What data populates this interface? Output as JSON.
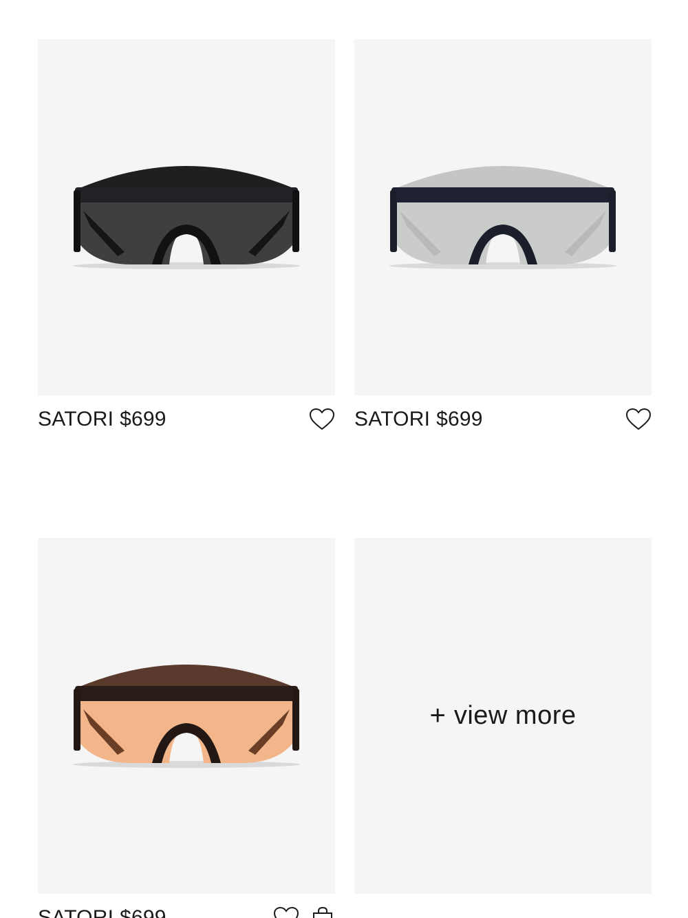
{
  "products": [
    {
      "name": "SATORI",
      "price": "$699",
      "lens_color": "#3f3f42",
      "visor_color": "#1f1f21",
      "frame_color": "#222226"
    },
    {
      "name": "SATORI",
      "price": "$699",
      "lens_color": "#c9ccc9",
      "visor_color": "#c4c6c3",
      "frame_color": "#1e2230"
    },
    {
      "name": "SATORI",
      "price": "$699",
      "lens_color": "#f2b68a",
      "visor_color": "#5a3a2c",
      "frame_color": "#2a1c18"
    }
  ],
  "view_more": {
    "plus": "+",
    "label": "view more"
  },
  "icons": {
    "favorite": "heart-icon",
    "bag": "shopping-bag-icon"
  },
  "colors": {
    "card_background": "#f5f5f5",
    "text": "#1a1a1a"
  }
}
